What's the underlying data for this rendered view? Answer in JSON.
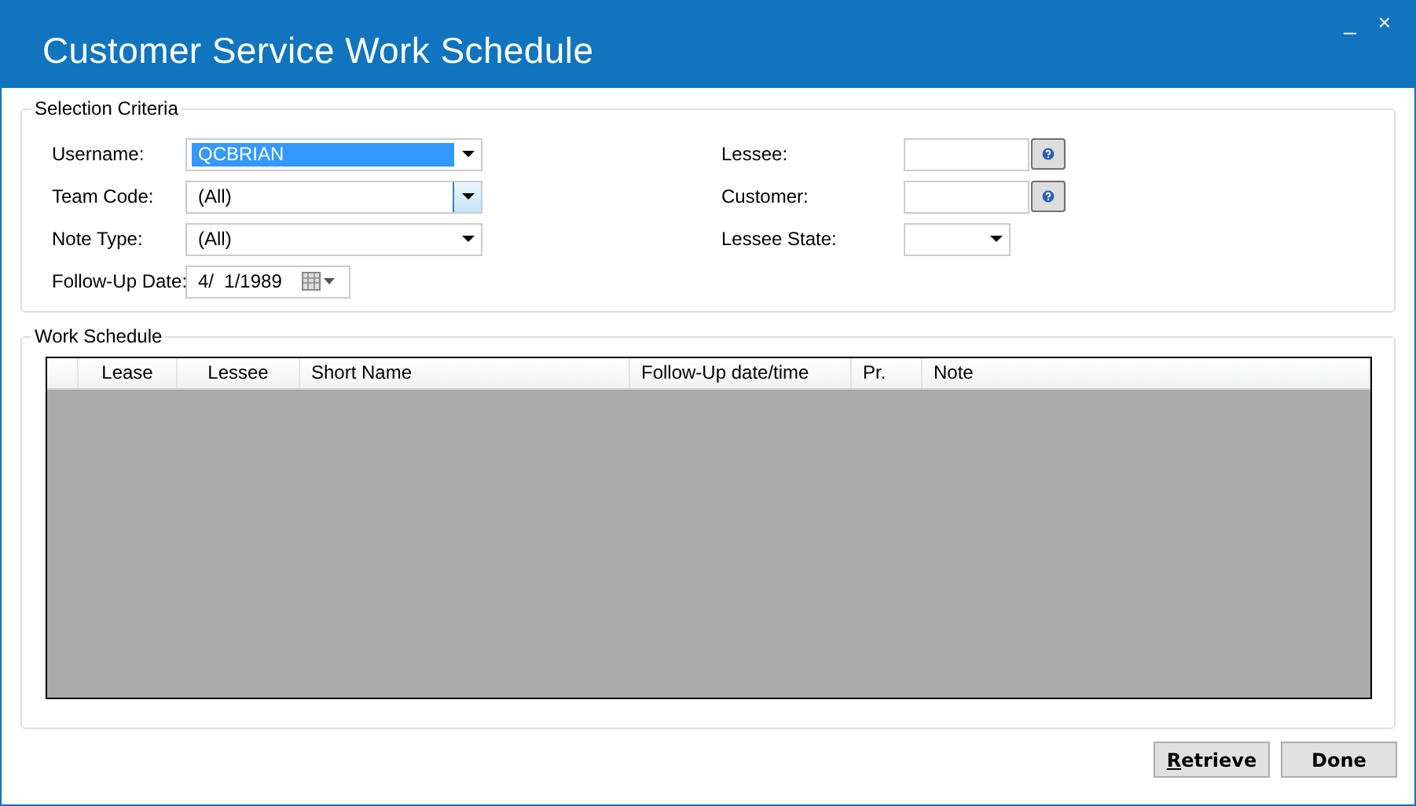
{
  "window": {
    "title": "Customer Service Work Schedule",
    "controls": [
      "_",
      "×"
    ]
  },
  "selection_criteria": {
    "title": "Selection Criteria",
    "left": [
      {
        "kind": "combo",
        "label": "Username:",
        "value": "QCBRIAN",
        "focused": true,
        "hovered": false
      },
      {
        "kind": "combo",
        "label": "Team Code:",
        "value": "(All)",
        "focused": false,
        "hovered": true
      },
      {
        "kind": "combo",
        "label": "Note Type:",
        "value": "(All)",
        "focused": false,
        "hovered": false
      },
      {
        "kind": "date",
        "label": "Follow-Up Date:",
        "value": "4/  1/1989"
      }
    ],
    "right": [
      {
        "kind": "lookup",
        "label": "Lessee:"
      },
      {
        "kind": "lookup",
        "label": "Customer:"
      },
      {
        "kind": "dropdown",
        "label": "Lessee State:"
      }
    ]
  },
  "work_schedule": {
    "title": "Work Schedule",
    "columns": [
      "Lease",
      "Lessee",
      "Short Name",
      "Follow-Up date/time",
      "Pr.",
      "Note"
    ]
  },
  "buttons": [
    {
      "label": "Retrieve",
      "mnemonic": true
    },
    {
      "label": "Done",
      "mnemonic": false
    }
  ]
}
